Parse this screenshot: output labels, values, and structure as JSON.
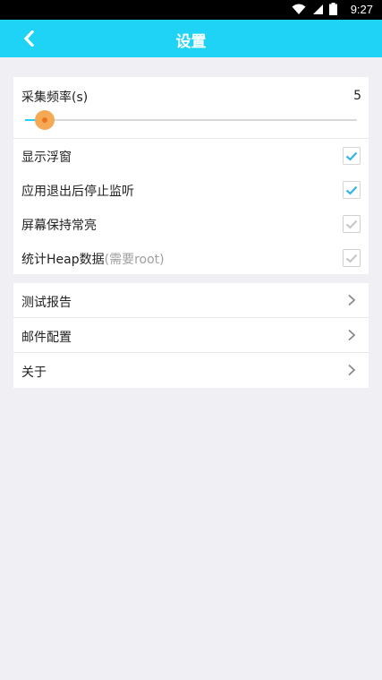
{
  "status_bar": {
    "time": "9:27",
    "icons": [
      "wifi-icon",
      "signal-icon",
      "battery-icon"
    ]
  },
  "app_bar": {
    "title": "设置",
    "back_icon": "chevron-left-icon",
    "color": "#1ed3f6"
  },
  "sampling": {
    "label": "采集频率(s)",
    "value": "5",
    "slider_level": 0.06
  },
  "toggles": [
    {
      "label": "显示浮窗",
      "hint": "",
      "checked": true
    },
    {
      "label": "应用退出后停止监听",
      "hint": "",
      "checked": true
    },
    {
      "label": "屏幕保持常亮",
      "hint": "",
      "checked": false
    },
    {
      "label": "统计Heap数据",
      "hint": "(需要root)",
      "checked": false
    }
  ],
  "nav_items": [
    {
      "label": "测试报告"
    },
    {
      "label": "邮件配置"
    },
    {
      "label": "关于"
    }
  ],
  "colors": {
    "accent": "#1ed3f6",
    "check": "#33b5e5",
    "thumb": "#f6a955",
    "background": "#efeff4"
  }
}
